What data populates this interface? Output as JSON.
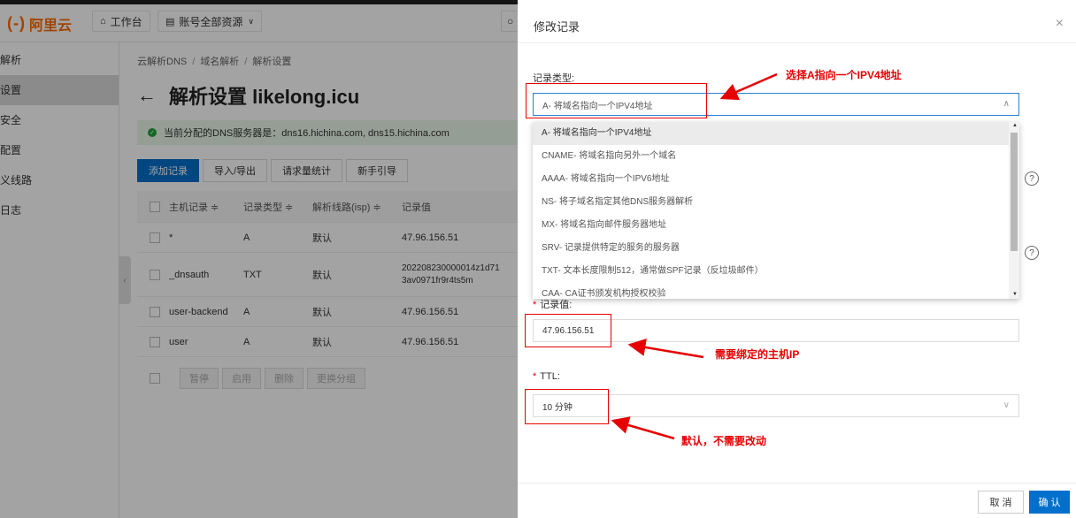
{
  "nav": {
    "logo_mark": "(-)",
    "logo_text": "阿里云",
    "workbench": "工作台",
    "resources": "账号全部资源"
  },
  "sidebar": {
    "items": [
      {
        "label": "解析"
      },
      {
        "label": "设置"
      },
      {
        "label": "安全"
      },
      {
        "label": "配置"
      },
      {
        "label": "义线路"
      },
      {
        "label": "日志"
      }
    ]
  },
  "main": {
    "breadcrumb": [
      "云解析DNS",
      "域名解析",
      "解析设置"
    ],
    "back_symbol": "←",
    "title": "解析设置 likelong.icu",
    "dns_notice": "当前分配的DNS服务器是：dns16.hichina.com, dns15.hichina.com",
    "tabs": [
      "添加记录",
      "导入/导出",
      "请求量统计",
      "新手引导"
    ],
    "table": {
      "headers": [
        "主机记录 ≑",
        "记录类型 ≑",
        "解析线路(isp) ≑",
        "记录值"
      ],
      "rows": [
        {
          "host": "*",
          "type": "A",
          "line": "默认",
          "value": "47.96.156.51",
          "value2": ""
        },
        {
          "host": "_dnsauth",
          "type": "TXT",
          "line": "默认",
          "value": "202208230000014z1d71",
          "value2": "3av0971fr9r4ts5m"
        },
        {
          "host": "user-backend",
          "type": "A",
          "line": "默认",
          "value": "47.96.156.51",
          "value2": ""
        },
        {
          "host": "user",
          "type": "A",
          "line": "默认",
          "value": "47.96.156.51",
          "value2": ""
        }
      ]
    },
    "bulk_actions": [
      "暂停",
      "启用",
      "删除",
      "更换分组"
    ]
  },
  "drawer": {
    "title": "修改记录",
    "close": "×",
    "record_type_label": "记录类型:",
    "record_type_value": "A- 将域名指向一个IPV4地址",
    "record_type_options": [
      "A- 将域名指向一个IPV4地址",
      "CNAME- 将域名指向另外一个域名",
      "AAAA- 将域名指向一个IPV6地址",
      "NS- 将子域名指定其他DNS服务器解析",
      "MX- 将域名指向邮件服务器地址",
      "SRV- 记录提供特定的服务的服务器",
      "TXT- 文本长度限制512，通常做SPF记录（反垃圾邮件）",
      "CAA- CA证书颁发机构授权校验"
    ],
    "record_value_label": "记录值:",
    "record_value": "47.96.156.51",
    "ttl_label": "TTL:",
    "ttl_value": "10 分钟",
    "help": "?",
    "cancel": "取 消",
    "confirm": "确 认"
  },
  "annotations": {
    "type_hint": "选择A指向一个IPV4地址",
    "ip_hint": "需要绑定的主机IP",
    "ttl_hint": "默认，不需要改动",
    "color": "#e60000"
  },
  "colors": {
    "brand": "#ff6a00",
    "primary": "#0070cc",
    "success": "#1fa33a"
  }
}
